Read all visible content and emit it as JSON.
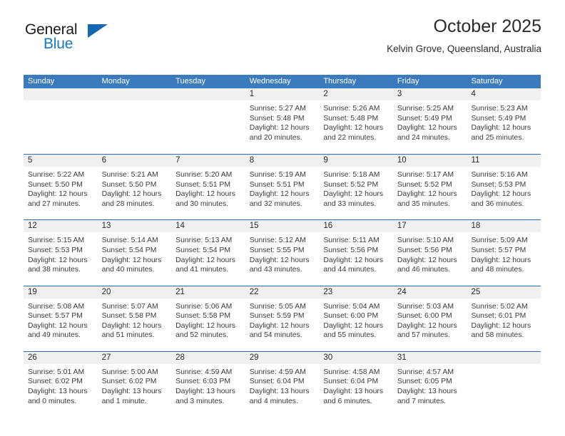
{
  "brand": {
    "name_top": "General",
    "name_bottom": "Blue",
    "accent_color": "#1778c4",
    "triangle_color": "#1567b2"
  },
  "header": {
    "title": "October 2025",
    "subtitle": "Kelvin Grove, Queensland, Australia"
  },
  "calendar": {
    "header_bg": "#3a7abd",
    "row_divider_color": "#2e6daf",
    "day_band_bg": "#f0f0f0",
    "weekdays": [
      "Sunday",
      "Monday",
      "Tuesday",
      "Wednesday",
      "Thursday",
      "Friday",
      "Saturday"
    ],
    "weeks": [
      [
        {
          "day": "",
          "lines": []
        },
        {
          "day": "",
          "lines": []
        },
        {
          "day": "",
          "lines": []
        },
        {
          "day": "1",
          "lines": [
            "Sunrise: 5:27 AM",
            "Sunset: 5:48 PM",
            "Daylight: 12 hours",
            "and 20 minutes."
          ]
        },
        {
          "day": "2",
          "lines": [
            "Sunrise: 5:26 AM",
            "Sunset: 5:48 PM",
            "Daylight: 12 hours",
            "and 22 minutes."
          ]
        },
        {
          "day": "3",
          "lines": [
            "Sunrise: 5:25 AM",
            "Sunset: 5:49 PM",
            "Daylight: 12 hours",
            "and 24 minutes."
          ]
        },
        {
          "day": "4",
          "lines": [
            "Sunrise: 5:23 AM",
            "Sunset: 5:49 PM",
            "Daylight: 12 hours",
            "and 25 minutes."
          ]
        }
      ],
      [
        {
          "day": "5",
          "lines": [
            "Sunrise: 5:22 AM",
            "Sunset: 5:50 PM",
            "Daylight: 12 hours",
            "and 27 minutes."
          ]
        },
        {
          "day": "6",
          "lines": [
            "Sunrise: 5:21 AM",
            "Sunset: 5:50 PM",
            "Daylight: 12 hours",
            "and 28 minutes."
          ]
        },
        {
          "day": "7",
          "lines": [
            "Sunrise: 5:20 AM",
            "Sunset: 5:51 PM",
            "Daylight: 12 hours",
            "and 30 minutes."
          ]
        },
        {
          "day": "8",
          "lines": [
            "Sunrise: 5:19 AM",
            "Sunset: 5:51 PM",
            "Daylight: 12 hours",
            "and 32 minutes."
          ]
        },
        {
          "day": "9",
          "lines": [
            "Sunrise: 5:18 AM",
            "Sunset: 5:52 PM",
            "Daylight: 12 hours",
            "and 33 minutes."
          ]
        },
        {
          "day": "10",
          "lines": [
            "Sunrise: 5:17 AM",
            "Sunset: 5:52 PM",
            "Daylight: 12 hours",
            "and 35 minutes."
          ]
        },
        {
          "day": "11",
          "lines": [
            "Sunrise: 5:16 AM",
            "Sunset: 5:53 PM",
            "Daylight: 12 hours",
            "and 36 minutes."
          ]
        }
      ],
      [
        {
          "day": "12",
          "lines": [
            "Sunrise: 5:15 AM",
            "Sunset: 5:53 PM",
            "Daylight: 12 hours",
            "and 38 minutes."
          ]
        },
        {
          "day": "13",
          "lines": [
            "Sunrise: 5:14 AM",
            "Sunset: 5:54 PM",
            "Daylight: 12 hours",
            "and 40 minutes."
          ]
        },
        {
          "day": "14",
          "lines": [
            "Sunrise: 5:13 AM",
            "Sunset: 5:54 PM",
            "Daylight: 12 hours",
            "and 41 minutes."
          ]
        },
        {
          "day": "15",
          "lines": [
            "Sunrise: 5:12 AM",
            "Sunset: 5:55 PM",
            "Daylight: 12 hours",
            "and 43 minutes."
          ]
        },
        {
          "day": "16",
          "lines": [
            "Sunrise: 5:11 AM",
            "Sunset: 5:56 PM",
            "Daylight: 12 hours",
            "and 44 minutes."
          ]
        },
        {
          "day": "17",
          "lines": [
            "Sunrise: 5:10 AM",
            "Sunset: 5:56 PM",
            "Daylight: 12 hours",
            "and 46 minutes."
          ]
        },
        {
          "day": "18",
          "lines": [
            "Sunrise: 5:09 AM",
            "Sunset: 5:57 PM",
            "Daylight: 12 hours",
            "and 48 minutes."
          ]
        }
      ],
      [
        {
          "day": "19",
          "lines": [
            "Sunrise: 5:08 AM",
            "Sunset: 5:57 PM",
            "Daylight: 12 hours",
            "and 49 minutes."
          ]
        },
        {
          "day": "20",
          "lines": [
            "Sunrise: 5:07 AM",
            "Sunset: 5:58 PM",
            "Daylight: 12 hours",
            "and 51 minutes."
          ]
        },
        {
          "day": "21",
          "lines": [
            "Sunrise: 5:06 AM",
            "Sunset: 5:58 PM",
            "Daylight: 12 hours",
            "and 52 minutes."
          ]
        },
        {
          "day": "22",
          "lines": [
            "Sunrise: 5:05 AM",
            "Sunset: 5:59 PM",
            "Daylight: 12 hours",
            "and 54 minutes."
          ]
        },
        {
          "day": "23",
          "lines": [
            "Sunrise: 5:04 AM",
            "Sunset: 6:00 PM",
            "Daylight: 12 hours",
            "and 55 minutes."
          ]
        },
        {
          "day": "24",
          "lines": [
            "Sunrise: 5:03 AM",
            "Sunset: 6:00 PM",
            "Daylight: 12 hours",
            "and 57 minutes."
          ]
        },
        {
          "day": "25",
          "lines": [
            "Sunrise: 5:02 AM",
            "Sunset: 6:01 PM",
            "Daylight: 12 hours",
            "and 58 minutes."
          ]
        }
      ],
      [
        {
          "day": "26",
          "lines": [
            "Sunrise: 5:01 AM",
            "Sunset: 6:02 PM",
            "Daylight: 13 hours",
            "and 0 minutes."
          ]
        },
        {
          "day": "27",
          "lines": [
            "Sunrise: 5:00 AM",
            "Sunset: 6:02 PM",
            "Daylight: 13 hours",
            "and 1 minute."
          ]
        },
        {
          "day": "28",
          "lines": [
            "Sunrise: 4:59 AM",
            "Sunset: 6:03 PM",
            "Daylight: 13 hours",
            "and 3 minutes."
          ]
        },
        {
          "day": "29",
          "lines": [
            "Sunrise: 4:59 AM",
            "Sunset: 6:04 PM",
            "Daylight: 13 hours",
            "and 4 minutes."
          ]
        },
        {
          "day": "30",
          "lines": [
            "Sunrise: 4:58 AM",
            "Sunset: 6:04 PM",
            "Daylight: 13 hours",
            "and 6 minutes."
          ]
        },
        {
          "day": "31",
          "lines": [
            "Sunrise: 4:57 AM",
            "Sunset: 6:05 PM",
            "Daylight: 13 hours",
            "and 7 minutes."
          ]
        },
        {
          "day": "",
          "lines": []
        }
      ]
    ]
  }
}
